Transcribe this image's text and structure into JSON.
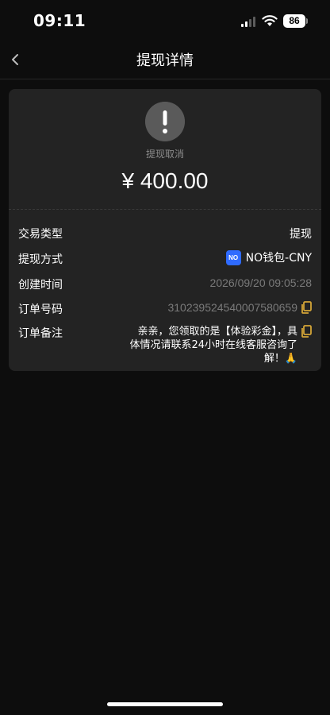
{
  "status_bar": {
    "time": "09:11",
    "battery": "86",
    "signal_icon": "cellular-signal-icon",
    "wifi_icon": "wifi-icon"
  },
  "nav": {
    "title": "提现详情",
    "back_icon": "chevron-left-icon"
  },
  "summary": {
    "status_icon": "exclamation-circle-icon",
    "status_text": "提现取消",
    "amount": "¥ 400.00"
  },
  "details": {
    "type_label": "交易类型",
    "type_value": "提现",
    "method_label": "提现方式",
    "method_logo": "NO",
    "method_value": "NO钱包-CNY",
    "created_label": "创建时间",
    "created_value": "2026/09/20 09:05:28",
    "order_label": "订单号码",
    "order_value": "3102395245400075806​59",
    "remark_label": "订单备注",
    "remark_value": "亲亲，您领取的是【体验彩金】，具体情况请联系24小时在线客服咨询了解！🙏"
  },
  "colors": {
    "background": "#0d0d0d",
    "card": "#232323",
    "copy_accent": "#d4a537",
    "wallet_logo": "#2f6bff",
    "status_icon_bg": "#5a5a5a"
  }
}
